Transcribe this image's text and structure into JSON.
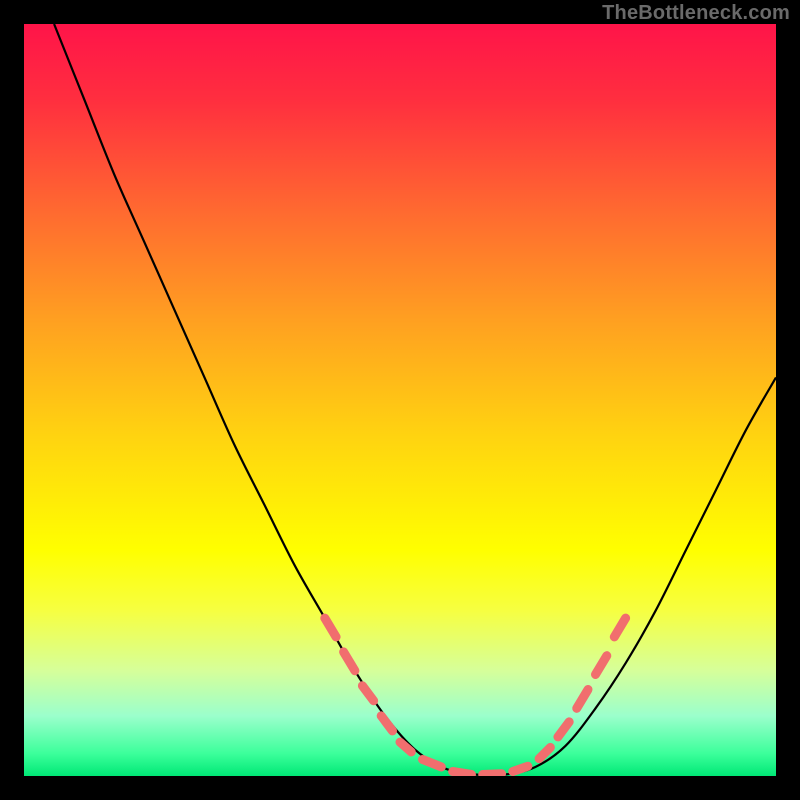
{
  "watermark": "TheBottleneck.com",
  "chart_data": {
    "type": "line",
    "title": "",
    "xlabel": "",
    "ylabel": "",
    "xlim": [
      0,
      100
    ],
    "ylim": [
      0,
      100
    ],
    "grid": false,
    "legend": false,
    "background_gradient": {
      "stops": [
        {
          "t": 0.0,
          "color": "#ff1449"
        },
        {
          "t": 0.1,
          "color": "#ff2e3f"
        },
        {
          "t": 0.25,
          "color": "#ff6a30"
        },
        {
          "t": 0.4,
          "color": "#ffa220"
        },
        {
          "t": 0.55,
          "color": "#ffd410"
        },
        {
          "t": 0.7,
          "color": "#ffff00"
        },
        {
          "t": 0.78,
          "color": "#f6ff41"
        },
        {
          "t": 0.86,
          "color": "#d6ff9a"
        },
        {
          "t": 0.92,
          "color": "#9bffcc"
        },
        {
          "t": 0.97,
          "color": "#3cff9b"
        },
        {
          "t": 1.0,
          "color": "#00e876"
        }
      ]
    },
    "series": [
      {
        "name": "bottleneck-curve",
        "color": "#000000",
        "points": [
          {
            "x": 4.0,
            "y": 100.0
          },
          {
            "x": 8.0,
            "y": 90.0
          },
          {
            "x": 12.0,
            "y": 80.0
          },
          {
            "x": 16.0,
            "y": 71.0
          },
          {
            "x": 20.0,
            "y": 62.0
          },
          {
            "x": 24.0,
            "y": 53.0
          },
          {
            "x": 28.0,
            "y": 44.0
          },
          {
            "x": 32.0,
            "y": 36.0
          },
          {
            "x": 36.0,
            "y": 28.0
          },
          {
            "x": 40.0,
            "y": 21.0
          },
          {
            "x": 44.0,
            "y": 14.0
          },
          {
            "x": 48.0,
            "y": 8.0
          },
          {
            "x": 52.0,
            "y": 3.5
          },
          {
            "x": 56.0,
            "y": 1.0
          },
          {
            "x": 60.0,
            "y": 0.2
          },
          {
            "x": 64.0,
            "y": 0.2
          },
          {
            "x": 68.0,
            "y": 1.2
          },
          {
            "x": 72.0,
            "y": 4.0
          },
          {
            "x": 76.0,
            "y": 9.0
          },
          {
            "x": 80.0,
            "y": 15.0
          },
          {
            "x": 84.0,
            "y": 22.0
          },
          {
            "x": 88.0,
            "y": 30.0
          },
          {
            "x": 92.0,
            "y": 38.0
          },
          {
            "x": 96.0,
            "y": 46.0
          },
          {
            "x": 100.0,
            "y": 53.0
          }
        ]
      },
      {
        "name": "highlight-dashes",
        "color": "#f16e6e",
        "segments": [
          {
            "x1": 40.0,
            "y1": 21.0,
            "x2": 41.5,
            "y2": 18.5
          },
          {
            "x1": 42.5,
            "y1": 16.5,
            "x2": 44.0,
            "y2": 14.0
          },
          {
            "x1": 45.0,
            "y1": 12.0,
            "x2": 46.5,
            "y2": 10.0
          },
          {
            "x1": 47.5,
            "y1": 8.0,
            "x2": 49.0,
            "y2": 6.0
          },
          {
            "x1": 50.0,
            "y1": 4.5,
            "x2": 51.5,
            "y2": 3.2
          },
          {
            "x1": 53.0,
            "y1": 2.2,
            "x2": 55.5,
            "y2": 1.2
          },
          {
            "x1": 57.0,
            "y1": 0.6,
            "x2": 59.5,
            "y2": 0.2
          },
          {
            "x1": 61.0,
            "y1": 0.2,
            "x2": 63.5,
            "y2": 0.3
          },
          {
            "x1": 65.0,
            "y1": 0.6,
            "x2": 67.0,
            "y2": 1.3
          },
          {
            "x1": 68.5,
            "y1": 2.3,
            "x2": 70.0,
            "y2": 3.8
          },
          {
            "x1": 71.0,
            "y1": 5.2,
            "x2": 72.5,
            "y2": 7.2
          },
          {
            "x1": 73.5,
            "y1": 9.0,
            "x2": 75.0,
            "y2": 11.5
          },
          {
            "x1": 76.0,
            "y1": 13.5,
            "x2": 77.5,
            "y2": 16.0
          },
          {
            "x1": 78.5,
            "y1": 18.5,
            "x2": 80.0,
            "y2": 21.0
          }
        ]
      }
    ]
  }
}
